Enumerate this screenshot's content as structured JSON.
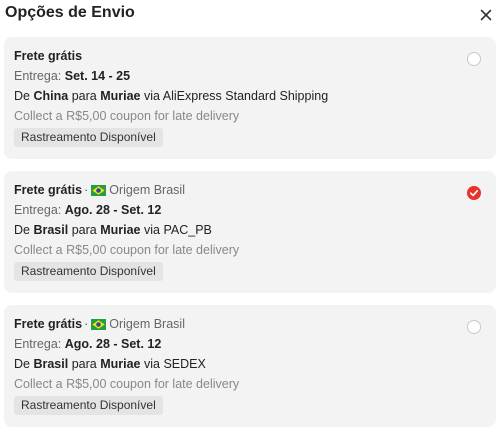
{
  "dialog": {
    "title": "Opções de Envio",
    "close_icon": "close-icon"
  },
  "options": [
    {
      "free_label": "Frete grátis",
      "origin_label": "",
      "delivery_prefix": "Entrega:",
      "delivery_range": "Set. 14 - 25",
      "route_from_prefix": "De",
      "from": "China",
      "route_to_prefix": "para",
      "to": "Muriae",
      "via_prefix": "via",
      "carrier": "AliExpress Standard Shipping",
      "coupon": "Collect a R$5,00 coupon for late delivery",
      "tracking": "Rastreamento Disponível",
      "selected": false
    },
    {
      "free_label": "Frete grátis",
      "origin_label": "Origem Brasil",
      "delivery_prefix": "Entrega:",
      "delivery_range": "Ago. 28 - Set. 12",
      "route_from_prefix": "De",
      "from": "Brasil",
      "route_to_prefix": "para",
      "to": "Muriae",
      "via_prefix": "via",
      "carrier": "PAC_PB",
      "coupon": "Collect a R$5,00 coupon for late delivery",
      "tracking": "Rastreamento Disponível",
      "selected": true
    },
    {
      "free_label": "Frete grátis",
      "origin_label": "Origem Brasil",
      "delivery_prefix": "Entrega:",
      "delivery_range": "Ago. 28 - Set. 12",
      "route_from_prefix": "De",
      "from": "Brasil",
      "route_to_prefix": "para",
      "to": "Muriae",
      "via_prefix": "via",
      "carrier": "SEDEX",
      "coupon": "Collect a R$5,00 coupon for late delivery",
      "tracking": "Rastreamento Disponível",
      "selected": false
    }
  ],
  "separator": "·",
  "colors": {
    "accent": "#e8322b",
    "card_bg": "#f3f3f3",
    "tag_bg": "#e4e4e4"
  }
}
